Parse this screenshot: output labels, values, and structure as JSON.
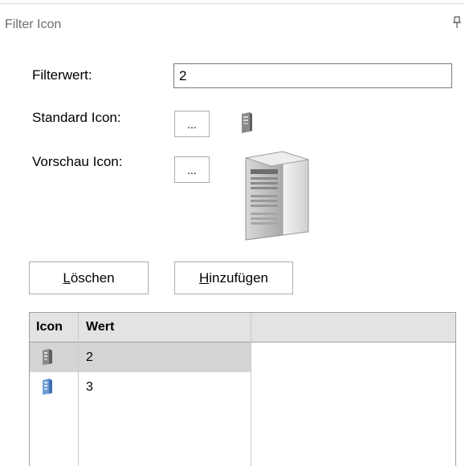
{
  "panel": {
    "title": "Filter Icon",
    "pin_glyph": "ꟷ"
  },
  "form": {
    "filter_label": "Filterwert:",
    "filter_value": "2",
    "standard_label": "Standard Icon:",
    "preview_label": "Vorschau Icon:",
    "browse_label": "...",
    "standard_icon": "server-icon-small",
    "preview_icon": "server-icon-large"
  },
  "buttons": {
    "delete_accel": "L",
    "delete_rest": "öschen",
    "add_accel": "H",
    "add_rest": "inzufügen"
  },
  "grid": {
    "columns": [
      "Icon",
      "Wert",
      ""
    ],
    "rows": [
      {
        "icon": "server-icon-gray",
        "value": "2",
        "selected": true
      },
      {
        "icon": "server-icon-blue",
        "value": "3",
        "selected": false
      }
    ]
  }
}
